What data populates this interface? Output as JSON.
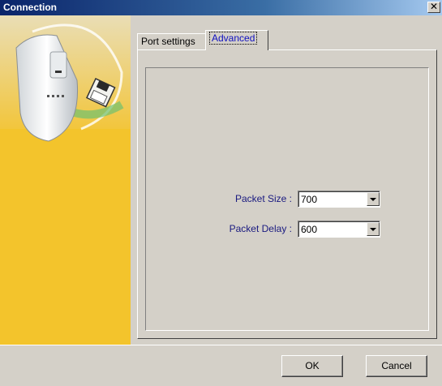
{
  "window": {
    "title": "Connection",
    "close_symbol": "✕"
  },
  "tabs": [
    {
      "label": "Port settings",
      "active": false
    },
    {
      "label": "Advanced",
      "active": true
    }
  ],
  "fields": {
    "packet_size": {
      "label": "Packet Size :",
      "value": "700"
    },
    "packet_delay": {
      "label": "Packet Delay :",
      "value": "600"
    }
  },
  "buttons": {
    "ok_label": "OK",
    "cancel_label": "Cancel"
  },
  "colors": {
    "title_bar": "#0a246a",
    "label_text": "#1a1a80",
    "active_tab_text": "#1010c0",
    "side_panel": "#f3c42c"
  },
  "icons": {
    "side_illustration": "device-with-floppy-disk"
  }
}
